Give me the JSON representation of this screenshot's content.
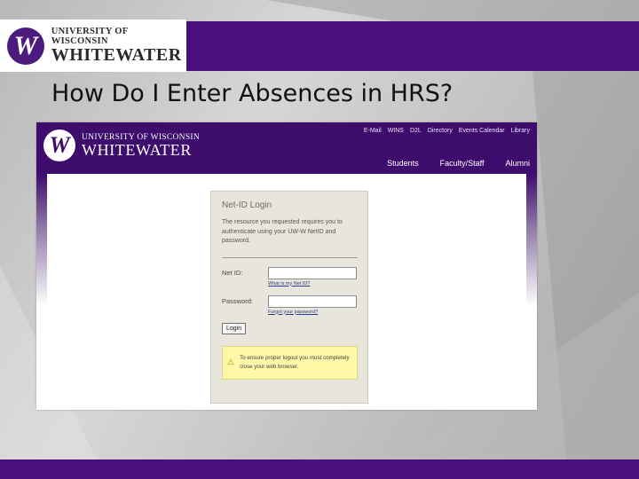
{
  "slide": {
    "logo_line1": "UNIVERSITY OF WISCONSIN",
    "logo_line2": "WHITEWATER",
    "logo_mark": "W",
    "title": "How Do I Enter Absences in HRS?"
  },
  "screenshot": {
    "logo_line1": "UNIVERSITY OF WISCONSIN",
    "logo_line2": "WHITEWATER",
    "logo_mark": "W",
    "utility_links": [
      "E-Mail",
      "WINS",
      "D2L",
      "Directory",
      "Events Calendar",
      "Library"
    ],
    "nav_links": [
      "Students",
      "Faculty/Staff",
      "Alumni"
    ],
    "login": {
      "title": "Net-ID Login",
      "message": "The resource you requested requires you to authenticate using your UW-W NetID and password.",
      "netid_label": "Net ID:",
      "netid_help": "What is my Net ID?",
      "password_label": "Password:",
      "password_help": "Forgot your password?",
      "button_label": "Login",
      "notice_icon": "warning-icon",
      "notice_text": "To ensure proper logout you must completely close your web browser."
    }
  },
  "colors": {
    "brand_purple": "#4b0f7d",
    "header_purple": "#3e0c6d",
    "panel_bg": "#e8e6dc",
    "notice_bg": "#fff8a8"
  }
}
